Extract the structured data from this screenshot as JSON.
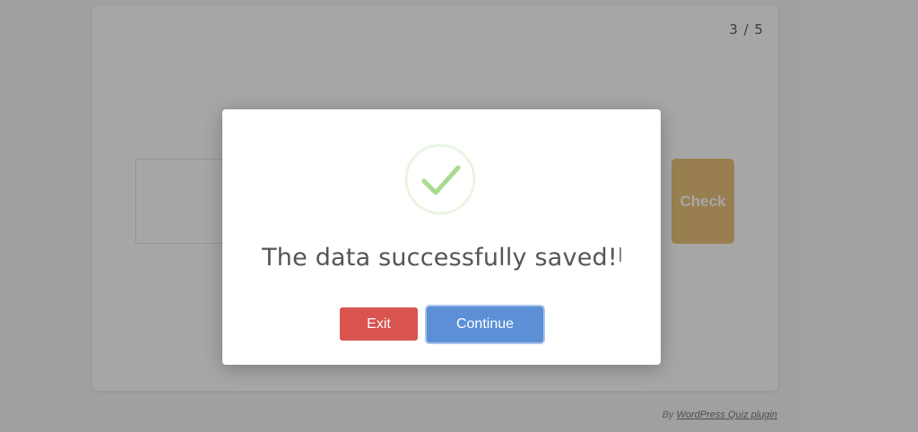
{
  "quiz": {
    "progress": "3 / 5",
    "check_label": "Check"
  },
  "footer": {
    "prefix": "By",
    "link_text": "WordPress Quiz plugin"
  },
  "modal": {
    "icon": "check-circle-icon",
    "message": "The data successfully saved",
    "message_end": "!",
    "exit_label": "Exit",
    "continue_label": "Continue"
  },
  "colors": {
    "success": "#a6dc8e",
    "exit": "#d9534f",
    "continue": "#5b8fd6",
    "check": "#e6b45a"
  }
}
